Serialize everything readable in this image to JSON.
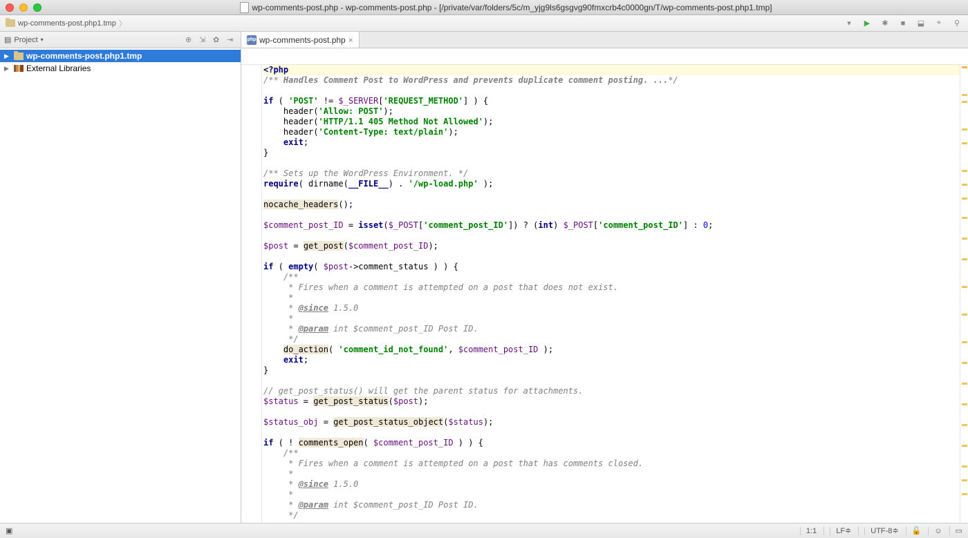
{
  "window": {
    "title": "wp-comments-post.php - wp-comments-post.php - [/private/var/folders/5c/m_yjg9ls6gsgvg90fmxcrb4c0000gn/T/wp-comments-post.php1.tmp]"
  },
  "breadcrumb": {
    "item": "wp-comments-post.php1.tmp"
  },
  "sidebar": {
    "header": "Project",
    "items": [
      {
        "label": "wp-comments-post.php1.tmp",
        "selected": true
      },
      {
        "label": "External Libraries",
        "selected": false
      }
    ]
  },
  "tabs": [
    {
      "label": "wp-comments-post.php",
      "active": true
    }
  ],
  "status": {
    "pos": "1:1",
    "line_sep": "LF",
    "encoding": "UTF-8"
  },
  "code": {
    "lines": [
      [
        {
          "t": "<?php",
          "c": "kw hl-line"
        }
      ],
      [
        {
          "t": "/** ",
          "c": "com"
        },
        {
          "t": "Handles Comment Post to WordPress and prevents duplicate comment posting. ...",
          "c": "comb"
        },
        {
          "t": "*/",
          "c": "com"
        }
      ],
      [],
      [
        {
          "t": "if",
          "c": "kw"
        },
        {
          "t": " ( "
        },
        {
          "t": "'POST'",
          "c": "str"
        },
        {
          "t": " != "
        },
        {
          "t": "$_SERVER",
          "c": "var"
        },
        {
          "t": "["
        },
        {
          "t": "'REQUEST_METHOD'",
          "c": "str"
        },
        {
          "t": "] ) {"
        }
      ],
      [
        {
          "t": "    "
        },
        {
          "t": "header",
          "c": "func"
        },
        {
          "t": "("
        },
        {
          "t": "'Allow: POST'",
          "c": "str"
        },
        {
          "t": ");"
        }
      ],
      [
        {
          "t": "    "
        },
        {
          "t": "header",
          "c": "func"
        },
        {
          "t": "("
        },
        {
          "t": "'HTTP/1.1 405 Method Not Allowed'",
          "c": "str"
        },
        {
          "t": ");"
        }
      ],
      [
        {
          "t": "    "
        },
        {
          "t": "header",
          "c": "func"
        },
        {
          "t": "("
        },
        {
          "t": "'Content-Type: text/plain'",
          "c": "str"
        },
        {
          "t": ");"
        }
      ],
      [
        {
          "t": "    "
        },
        {
          "t": "exit",
          "c": "kw"
        },
        {
          "t": ";"
        }
      ],
      [
        {
          "t": "}"
        }
      ],
      [],
      [
        {
          "t": "/** Sets up the WordPress Environment. */",
          "c": "com"
        }
      ],
      [
        {
          "t": "require",
          "c": "kw"
        },
        {
          "t": "( "
        },
        {
          "t": "dirname",
          "c": "func"
        },
        {
          "t": "("
        },
        {
          "t": "__FILE__",
          "c": "kw"
        },
        {
          "t": ") . "
        },
        {
          "t": "'/wp-load.php'",
          "c": "str"
        },
        {
          "t": " );"
        }
      ],
      [],
      [
        {
          "t": "nocache_headers",
          "c": "ident bg"
        },
        {
          "t": "();"
        }
      ],
      [],
      [
        {
          "t": "$comment_post_ID",
          "c": "var"
        },
        {
          "t": " = "
        },
        {
          "t": "isset",
          "c": "kw"
        },
        {
          "t": "("
        },
        {
          "t": "$_POST",
          "c": "var"
        },
        {
          "t": "["
        },
        {
          "t": "'comment_post_ID'",
          "c": "str"
        },
        {
          "t": "]) ? ("
        },
        {
          "t": "int",
          "c": "kw"
        },
        {
          "t": ") "
        },
        {
          "t": "$_POST",
          "c": "var"
        },
        {
          "t": "["
        },
        {
          "t": "'comment_post_ID'",
          "c": "str"
        },
        {
          "t": "] : "
        },
        {
          "t": "0",
          "c": "num"
        },
        {
          "t": ";"
        }
      ],
      [],
      [
        {
          "t": "$post",
          "c": "var"
        },
        {
          "t": " = "
        },
        {
          "t": "get_post",
          "c": "ident bg"
        },
        {
          "t": "("
        },
        {
          "t": "$comment_post_ID",
          "c": "var"
        },
        {
          "t": ");"
        }
      ],
      [],
      [
        {
          "t": "if",
          "c": "kw"
        },
        {
          "t": " ( "
        },
        {
          "t": "empty",
          "c": "kw"
        },
        {
          "t": "( "
        },
        {
          "t": "$post",
          "c": "var"
        },
        {
          "t": "->"
        },
        {
          "t": "comment_status",
          "c": "ident"
        },
        {
          "t": " ) ) {"
        }
      ],
      [
        {
          "t": "    /**",
          "c": "com"
        }
      ],
      [
        {
          "t": "     * Fires when a comment is attempted on a post that does not exist.",
          "c": "com"
        }
      ],
      [
        {
          "t": "     *",
          "c": "com"
        }
      ],
      [
        {
          "t": "     * ",
          "c": "com"
        },
        {
          "t": "@since",
          "c": "comb underline"
        },
        {
          "t": " 1.5.0",
          "c": "com"
        }
      ],
      [
        {
          "t": "     *",
          "c": "com"
        }
      ],
      [
        {
          "t": "     * ",
          "c": "com"
        },
        {
          "t": "@param",
          "c": "comb underline"
        },
        {
          "t": " int $comment_post_ID Post ID.",
          "c": "com"
        }
      ],
      [
        {
          "t": "     */",
          "c": "com"
        }
      ],
      [
        {
          "t": "    "
        },
        {
          "t": "do_action",
          "c": "ident bg"
        },
        {
          "t": "( "
        },
        {
          "t": "'comment_id_not_found'",
          "c": "str"
        },
        {
          "t": ", "
        },
        {
          "t": "$comment_post_ID",
          "c": "var"
        },
        {
          "t": " );"
        }
      ],
      [
        {
          "t": "    "
        },
        {
          "t": "exit",
          "c": "kw"
        },
        {
          "t": ";"
        }
      ],
      [
        {
          "t": "}"
        }
      ],
      [],
      [
        {
          "t": "// get_post_status() will get the parent status for attachments.",
          "c": "com"
        }
      ],
      [
        {
          "t": "$status",
          "c": "var"
        },
        {
          "t": " = "
        },
        {
          "t": "get_post_status",
          "c": "ident bg"
        },
        {
          "t": "("
        },
        {
          "t": "$post",
          "c": "var"
        },
        {
          "t": ");"
        }
      ],
      [],
      [
        {
          "t": "$status_obj",
          "c": "var"
        },
        {
          "t": " = "
        },
        {
          "t": "get_post_status_object",
          "c": "ident bg"
        },
        {
          "t": "("
        },
        {
          "t": "$status",
          "c": "var"
        },
        {
          "t": ");"
        }
      ],
      [],
      [
        {
          "t": "if",
          "c": "kw"
        },
        {
          "t": " ( ! "
        },
        {
          "t": "comments_open",
          "c": "ident bg"
        },
        {
          "t": "( "
        },
        {
          "t": "$comment_post_ID",
          "c": "var"
        },
        {
          "t": " ) ) {"
        }
      ],
      [
        {
          "t": "    /**",
          "c": "com"
        }
      ],
      [
        {
          "t": "     * Fires when a comment is attempted on a post that has comments closed.",
          "c": "com"
        }
      ],
      [
        {
          "t": "     *",
          "c": "com"
        }
      ],
      [
        {
          "t": "     * ",
          "c": "com"
        },
        {
          "t": "@since",
          "c": "comb underline"
        },
        {
          "t": " 1.5.0",
          "c": "com"
        }
      ],
      [
        {
          "t": "     *",
          "c": "com"
        }
      ],
      [
        {
          "t": "     * ",
          "c": "com"
        },
        {
          "t": "@param",
          "c": "comb underline"
        },
        {
          "t": " int $comment_post_ID Post ID.",
          "c": "com"
        }
      ],
      [
        {
          "t": "     */",
          "c": "com"
        }
      ]
    ]
  }
}
